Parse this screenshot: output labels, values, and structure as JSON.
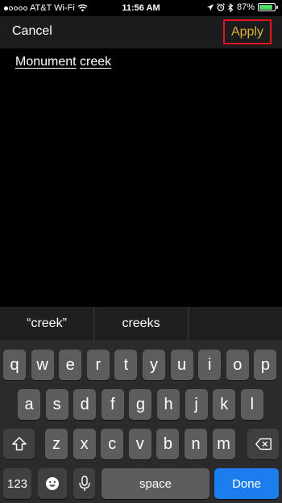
{
  "status_bar": {
    "carrier": "AT&T Wi-Fi",
    "time": "11:56 AM",
    "battery_percent": "87%",
    "battery_level": 0.87,
    "battery_color": "#4cd964",
    "signal_bars_filled": 1,
    "signal_bars_total": 5,
    "icons": [
      "wifi-icon",
      "location-icon",
      "alarm-icon",
      "bluetooth-icon"
    ]
  },
  "nav": {
    "cancel_label": "Cancel",
    "apply_label": "Apply",
    "apply_color": "#d8b23a",
    "highlight_color": "#e8141c"
  },
  "text_area": {
    "words": [
      "Monument",
      "creek"
    ]
  },
  "suggestions": [
    "“creek”",
    "creeks",
    ""
  ],
  "keyboard": {
    "row1": [
      "q",
      "w",
      "e",
      "r",
      "t",
      "y",
      "u",
      "i",
      "o",
      "p"
    ],
    "row2": [
      "a",
      "s",
      "d",
      "f",
      "g",
      "h",
      "j",
      "k",
      "l"
    ],
    "row3": [
      "z",
      "x",
      "c",
      "v",
      "b",
      "n",
      "m"
    ],
    "numbers_label": "123",
    "space_label": "space",
    "done_label": "Done",
    "done_color": "#1b7dee",
    "icons": [
      "shift-icon",
      "delete-icon",
      "emoji-icon",
      "microphone-icon"
    ]
  }
}
